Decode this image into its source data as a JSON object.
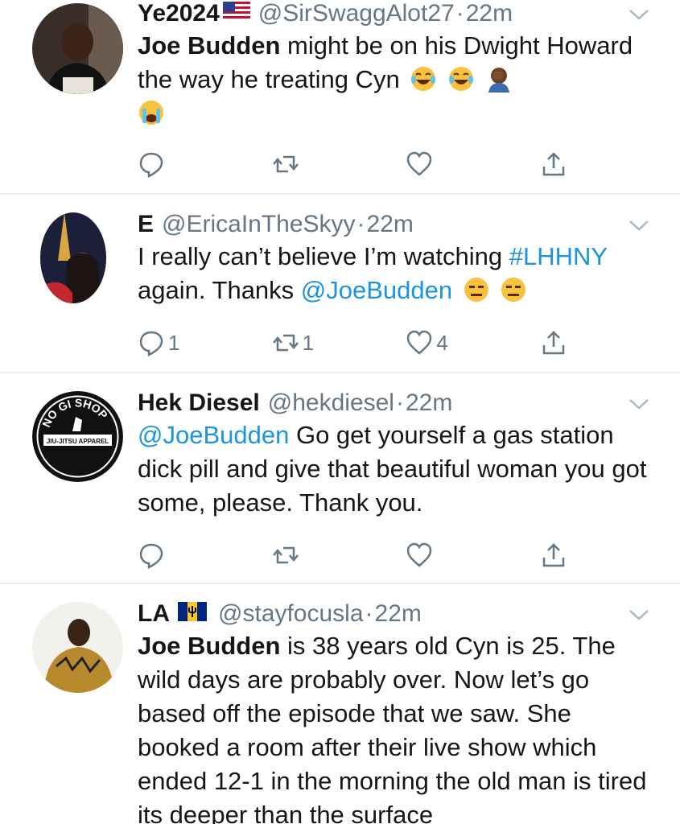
{
  "tweets": [
    {
      "name": "Ye2024",
      "handle": "@SirSwaggAlot27",
      "separator": "·",
      "time": "22m",
      "text_bold": "Joe Budden",
      "text_rest": " might be on his Dwight Howard the way he treating Cyn",
      "reply_count": "",
      "retweet_count": "",
      "like_count": ""
    },
    {
      "name": "E",
      "handle": "@EricaInTheSkyy",
      "separator": "·",
      "time": "22m",
      "text_a": "I really can’t believe I’m watching ",
      "hashtag": "#LHHNY",
      "text_b": " again. Thanks ",
      "mention": "@JoeBudden",
      "reply_count": "1",
      "retweet_count": "1",
      "like_count": "4"
    },
    {
      "name": "Hek Diesel",
      "handle": "@hekdiesel",
      "separator": "·",
      "time": "22m",
      "mention": "@JoeBudden",
      "text_rest": " Go get yourself a gas station dick pill and give that beautiful woman you got some, please.  Thank you.",
      "avatar_text_top": "NO GI SHOP",
      "avatar_text_bottom": "JIU-JITSU APPAREL",
      "reply_count": "",
      "retweet_count": "",
      "like_count": ""
    },
    {
      "name": "LA",
      "handle": "@stayfocusla",
      "separator": "·",
      "time": "22m",
      "text_bold": "Joe Budden",
      "text_rest": " is 38 years old Cyn is 25. The wild days are probably over. Now let’s go based off the episode that we saw. She booked a room after their live show which ended 12-1 in the morning the old man is tired its deeper than the surface"
    }
  ],
  "colors": {
    "link": "#1b95e0",
    "muted": "#657786",
    "divider": "#e6ecf0"
  },
  "icons": [
    "reply-icon",
    "retweet-icon",
    "like-icon",
    "share-icon",
    "chevron-down-icon"
  ]
}
